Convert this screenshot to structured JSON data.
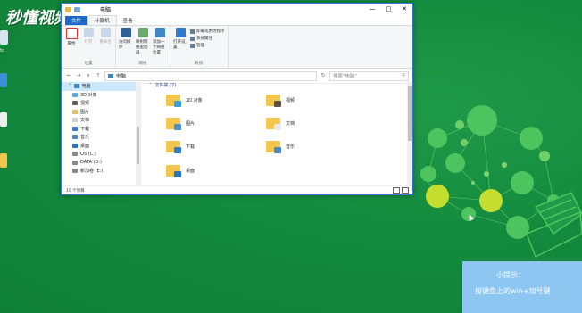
{
  "brand": "秒懂视频",
  "desktop": {
    "icon_labels": [
      "tc"
    ]
  },
  "window": {
    "title": "电脑",
    "tabs": [
      "文件",
      "计算机",
      "查看"
    ],
    "ribbon": {
      "groups": [
        {
          "label": "位置",
          "buttons": [
            "属性",
            "打开",
            "重命名"
          ]
        },
        {
          "label": "网络",
          "buttons": [
            "访问媒体",
            "映射网络驱动器",
            "添加一个网络位置"
          ]
        },
        {
          "label": "系统",
          "buttons": [
            "打开设置"
          ],
          "small": [
            "卸载或更改程序",
            "系统属性",
            "管理"
          ]
        }
      ]
    },
    "address": {
      "path": "电脑",
      "search_placeholder": "搜索\"电脑\""
    },
    "nav_items": [
      "电脑",
      "3D 对象",
      "视频",
      "图片",
      "文档",
      "下载",
      "音乐",
      "桌面",
      "OS (C:)",
      "DATA (D:)",
      "新加卷 (E:)"
    ],
    "content": {
      "group_header": "文件夹 (7)",
      "folders": [
        "3D 对象",
        "视频",
        "图片",
        "文档",
        "下载",
        "音乐",
        "桌面"
      ]
    },
    "status": "15 个项目"
  },
  "tip": {
    "title": "小提示：",
    "text": "按键盘上的win+加号键"
  },
  "colors": {
    "desktop": "#11853a",
    "accent": "#1b6ac9",
    "tip": "#8ec6f2",
    "folder": "#f3c74d"
  }
}
